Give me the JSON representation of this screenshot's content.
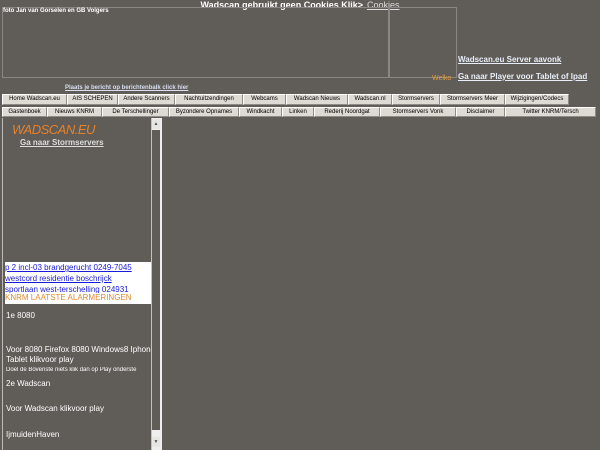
{
  "cookie_banner": {
    "text": "Wadscan gebruikt geen Cookies Klik>",
    "link": "Cookies"
  },
  "photo_credit": "foto Jan van Gorselen en GB Volgers",
  "header_links": {
    "server": "Wadscan.eu Server aavonk",
    "player": "Ga naar Player voor Tablet of Ipad",
    "welkom": "Welko"
  },
  "post_message": "Plaats je bericht op berichtenbalk click hier",
  "nav_row_1": [
    "Home Wadscan.eu",
    "AIS SCHEPEN",
    "Andere Scanners",
    "Nachtuitzendingen",
    "Webcams",
    "Wadscan Nieuws",
    "Wadscan.nl",
    "Stormservers",
    "Stormservers Meer",
    "Wijzigingen/Codecs"
  ],
  "nav_row_2": [
    "Gastenboek",
    "Nieuws KNRM",
    "De Terschellinger",
    "Byzondere Opnames",
    "Windkacht",
    "Linken",
    "Rederij Noordgat",
    "Stormservers Vonk",
    "Disclaimer",
    "Twitter KNRM/Tersch"
  ],
  "sidebar": {
    "logo": "WADSCAN.EU",
    "storm_link": "Ga naar Stormservers",
    "alerts": [
      "p 2 incl-03 brandgerucht 0249-7045",
      "westcord residentie boschrijck",
      "sportlaan west-terschelling 024931"
    ],
    "knrm_label": "KNRM LAATSTE ALARMERINGEN",
    "lines": [
      "1e 8080",
      "Voor 8080 Firefox 8080 Windows8 Iphone",
      "Tablet klikvoor play",
      "Doel de Bovenste niets klik dan op Play onderste",
      "2e Wadscan",
      "Voor Wadscan klikvoor play",
      "IjmuidenHaven"
    ]
  }
}
